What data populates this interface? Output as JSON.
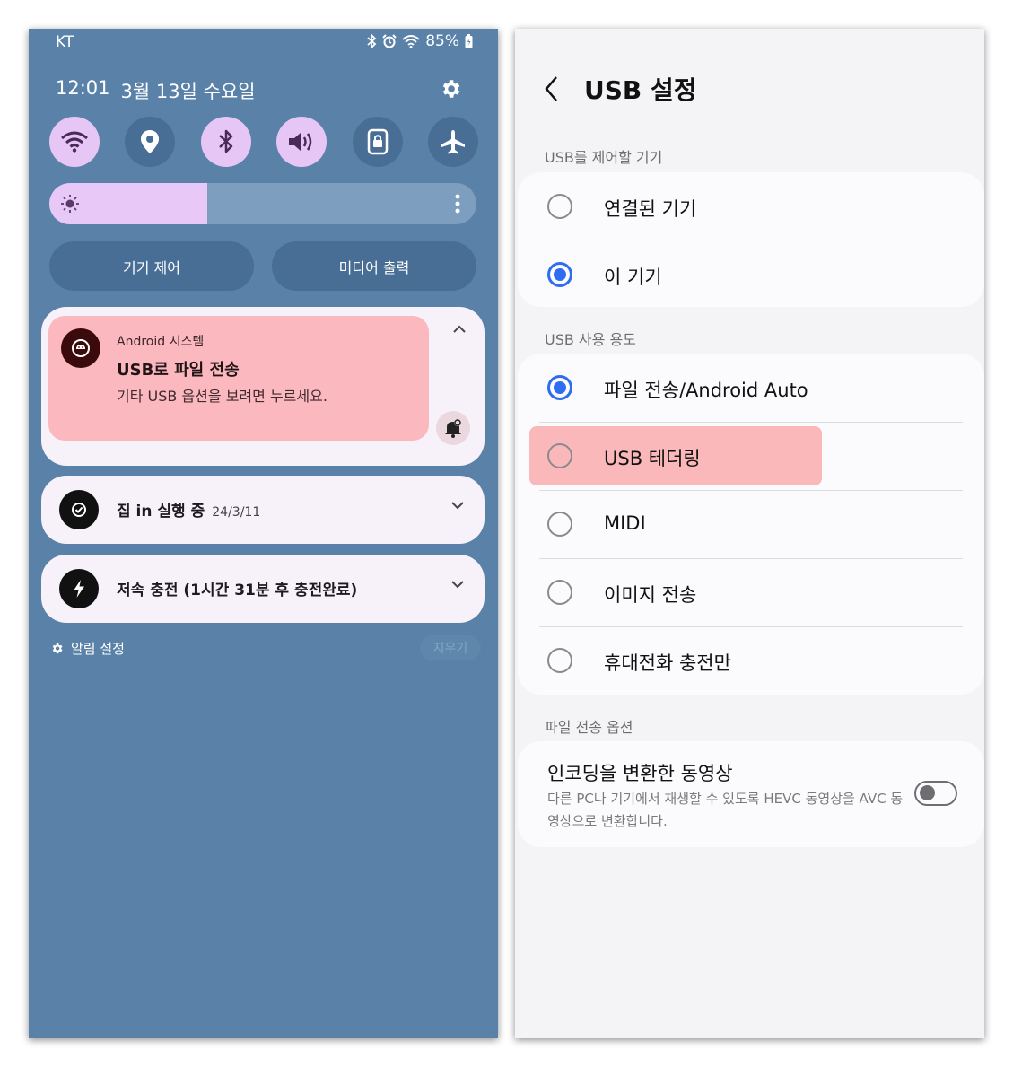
{
  "status_bar": {
    "carrier": "KT",
    "battery": "85%"
  },
  "header": {
    "time": "12:01",
    "date": "3월 13일 수요일"
  },
  "quick_settings": [
    {
      "icon": "wifi-icon",
      "state": "on"
    },
    {
      "icon": "location-icon",
      "state": "off"
    },
    {
      "icon": "bluetooth-icon",
      "state": "on"
    },
    {
      "icon": "sound-icon",
      "state": "on"
    },
    {
      "icon": "rotation-lock-icon",
      "state": "off"
    },
    {
      "icon": "airplane-icon",
      "state": "off"
    }
  ],
  "brightness": {
    "level": 0.37
  },
  "pills": {
    "device_control": "기기 제어",
    "media_output": "미디어 출력"
  },
  "notification": {
    "app": "Android 시스템",
    "title": "USB로 파일 전송",
    "text": "기타 USB 옵션을 보려면 누르세요."
  },
  "notifications_small": [
    {
      "title": "집 in 실행 중",
      "date": "24/3/11"
    },
    {
      "title": "저속 충전 (1시간 31분 후 충전완료)",
      "date": ""
    }
  ],
  "footer": {
    "alarm_settings": "알림 설정",
    "clear": "지우기"
  },
  "usb_settings": {
    "title": "USB 설정",
    "section_controller": "USB를 제어할 기기",
    "controller_options": [
      "연결된 기기",
      "이 기기"
    ],
    "controller_selected": 1,
    "section_usage": "USB 사용 용도",
    "usage_options": [
      "파일 전송/Android Auto",
      "USB 테더링",
      "MIDI",
      "이미지 전송",
      "휴대전화 충전만"
    ],
    "usage_selected": 0,
    "section_file": "파일 전송 옵션",
    "transcode_title": "인코딩을 변환한 동영상",
    "transcode_desc": "다른 PC나 기기에서 재생할 수 있도록 HEVC 동영상을 AVC 동영상으로 변환합니다.",
    "transcode_enabled": false
  },
  "colors": {
    "panel_bg": "#5a82a8",
    "qs_on": "#e6c6f5",
    "qs_off": "#486e96",
    "notif_highlight": "#fbb8bf",
    "radio_selected": "#2f6cf0"
  }
}
